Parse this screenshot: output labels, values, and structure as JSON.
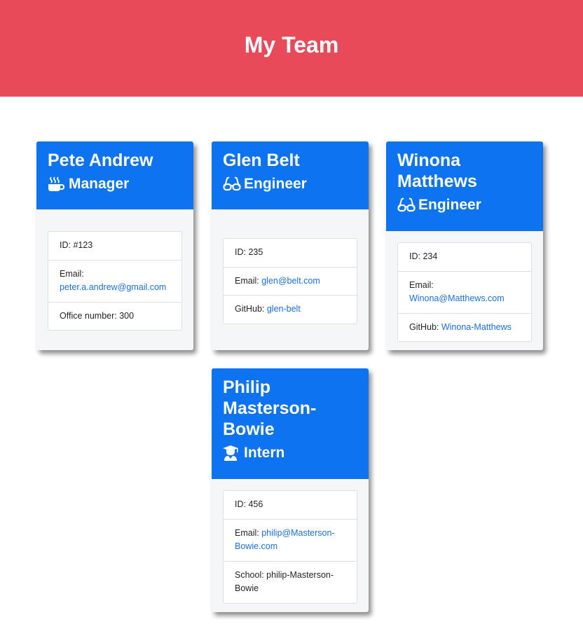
{
  "header": {
    "title": "My Team"
  },
  "colors": {
    "banner": "#e84a5a",
    "card_header": "#0d73f0",
    "link": "#1a6fd6"
  },
  "cards": [
    {
      "name": "Pete Andrew",
      "role": "Manager",
      "role_icon": "coffee-mug-icon",
      "id_text": "ID: #123",
      "email_label": "Email: ",
      "email": "peter.a.andrew@gmail.com",
      "extra_text": "Office number: 300"
    },
    {
      "name": "Glen Belt",
      "role": "Engineer",
      "role_icon": "glasses-icon",
      "id_text": "ID: 235",
      "email_label": "Email: ",
      "email": "glen@belt.com",
      "extra_label": "GitHub: ",
      "extra_link": "glen-belt"
    },
    {
      "name_line1": "Winona",
      "name_line2": "Matthews",
      "role": "Engineer",
      "role_icon": "glasses-icon",
      "id_text": "ID: 234",
      "email_label": "Email: ",
      "email": "Winona@Matthews.com",
      "extra_label": "GitHub: ",
      "extra_link": "Winona-Matthews"
    },
    {
      "name_line1": "Philip",
      "name_line2": "Masterson-",
      "name_line3": "Bowie",
      "role": "Intern",
      "role_icon": "graduate-icon",
      "id_text": "ID: 456",
      "email_label": "Email: ",
      "email_line1": "philip@Masterson-",
      "email_line2": "Bowie.com",
      "school_line1": "School: philip-Masterson-",
      "school_line2": "Bowie"
    }
  ]
}
